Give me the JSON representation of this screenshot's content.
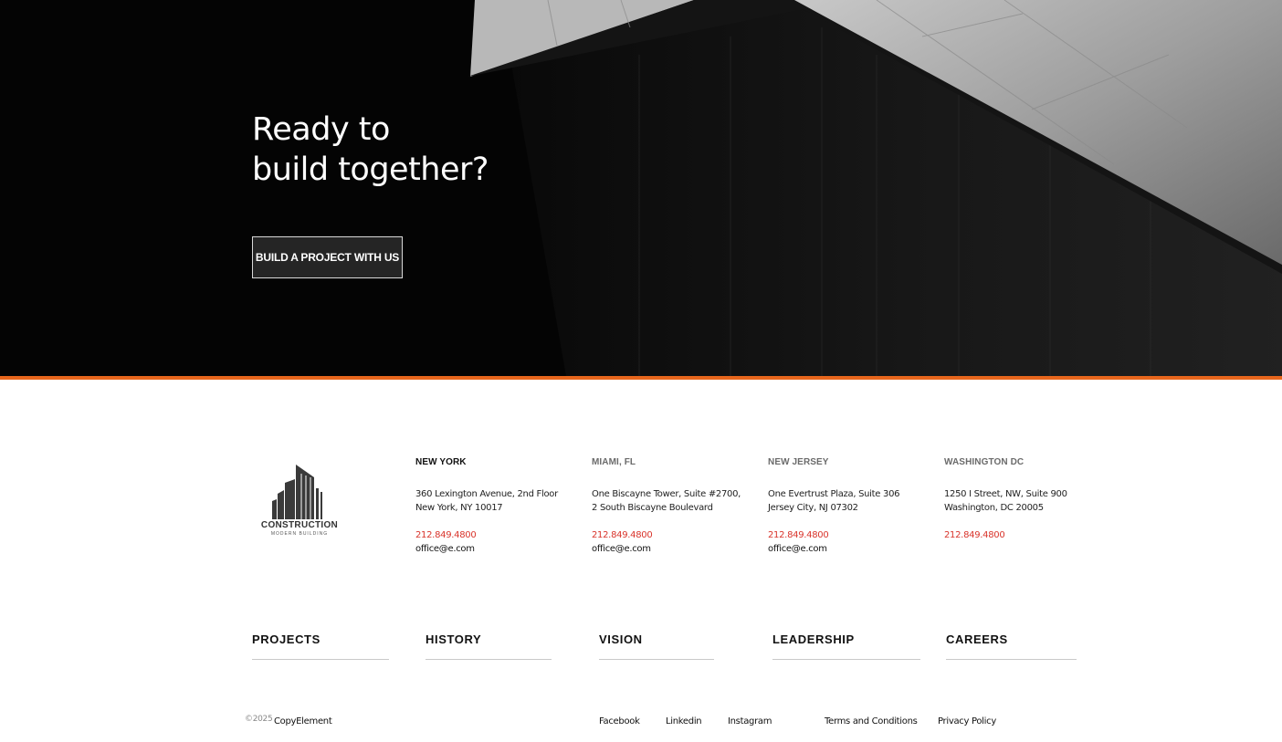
{
  "hero": {
    "title_line1": "Ready to",
    "title_line2": "build together?",
    "cta_label": "BUILD A PROJECT WITH US"
  },
  "colors": {
    "accent": "#e8661c",
    "phone": "#d9342b",
    "hero_bg": "#050505"
  },
  "logo": {
    "icon": "building-logo-icon",
    "wordmark": "CONSTRUCTION",
    "tagline": "MODERN BUILDING"
  },
  "offices": [
    {
      "city": "NEW YORK",
      "address_line1": "360 Lexington Avenue, 2nd Floor",
      "address_line2": "New York, NY 10017",
      "phone": "212.849.4800",
      "email": "office@e.com"
    },
    {
      "city": "MIAMI, FL",
      "address_line1": "One Biscayne Tower, Suite #2700,",
      "address_line2": "2 South Biscayne Boulevard",
      "phone": "212.849.4800",
      "email": "office@e.com"
    },
    {
      "city": "NEW JERSEY",
      "address_line1": "One Evertrust Plaza, Suite 306",
      "address_line2": "Jersey City, NJ 07302",
      "phone": "212.849.4800",
      "email": "office@e.com"
    },
    {
      "city": "WASHINGTON DC",
      "address_line1": "1250 I Street, NW, Suite 900",
      "address_line2": "Washington, DC 20005",
      "phone": "212.849.4800",
      "email": ""
    }
  ],
  "nav": {
    "items": [
      "PROJECTS",
      "HISTORY",
      "VISION",
      "LEADERSHIP",
      "CAREERS"
    ]
  },
  "footer": {
    "copyright_year": "©2025",
    "copyright_name": "CopyElement",
    "social": [
      "Facebook",
      "Linkedin",
      "Instagram"
    ],
    "legal": [
      "Terms and Conditions",
      "Privacy Policy"
    ]
  }
}
